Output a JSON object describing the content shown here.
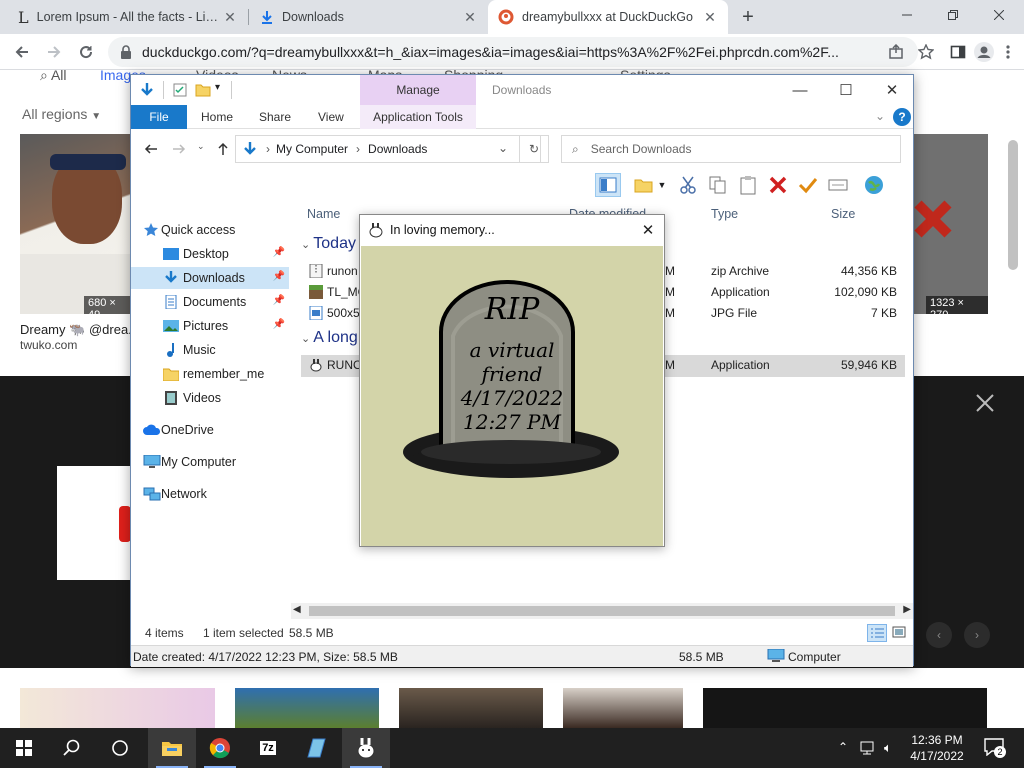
{
  "browser": {
    "tabs": [
      {
        "title": "Lorem Ipsum - All the facts - Lipsum",
        "favicon": "L"
      },
      {
        "title": "Downloads",
        "favicon": "download-icon"
      },
      {
        "title": "dreamybullxxx at DuckDuckGo",
        "favicon": "duckduckgo-icon",
        "active": true
      }
    ],
    "url": "duckduckgo.com/?q=dreamybullxxx&t=h_&iax=images&ia=images&iai=https%3A%2F%2Fei.phprcdn.com%2F..."
  },
  "ddg": {
    "tabs": [
      "All",
      "Images",
      "Videos",
      "News",
      "Maps",
      "Shopping",
      "Settings"
    ],
    "all_regions": "All regions",
    "result": {
      "title": "Dreamy",
      "emoji": "🐃",
      "handle": "@drea...",
      "source": "twuko.com",
      "dims": "680 × 49..."
    },
    "right_dims": "1323 × 270"
  },
  "explorer": {
    "manage": "Manage",
    "title": "Downloads",
    "ribbon": {
      "file": "File",
      "home": "Home",
      "share": "Share",
      "view": "View",
      "app_tools": "Application Tools"
    },
    "breadcrumb": [
      "My Computer",
      "Downloads"
    ],
    "search_placeholder": "Search Downloads",
    "nav": [
      {
        "label": "Quick access",
        "icon": "star-icon"
      },
      {
        "label": "Desktop",
        "icon": "desktop-icon",
        "pinned": true
      },
      {
        "label": "Downloads",
        "icon": "download-icon",
        "pinned": true,
        "selected": true
      },
      {
        "label": "Documents",
        "icon": "document-icon",
        "pinned": true
      },
      {
        "label": "Pictures",
        "icon": "picture-icon",
        "pinned": true
      },
      {
        "label": "Music",
        "icon": "music-icon"
      },
      {
        "label": "remember_me",
        "icon": "folder-icon"
      },
      {
        "label": "Videos",
        "icon": "video-icon"
      },
      {
        "label": "OneDrive",
        "icon": "cloud-icon"
      },
      {
        "label": "My Computer",
        "icon": "computer-icon"
      },
      {
        "label": "Network",
        "icon": "network-icon"
      }
    ],
    "columns": {
      "name": "Name",
      "date": "Date modified",
      "type": "Type",
      "size": "Size"
    },
    "groups": [
      "Today (",
      "A long"
    ],
    "files": [
      {
        "name": "runon",
        "date_tail": "M",
        "type": "zip Archive",
        "size": "44,356 KB"
      },
      {
        "name": "TL_MC",
        "date_tail": "M",
        "type": "Application",
        "size": "102,090 KB"
      },
      {
        "name": "500x50",
        "date_tail": "M",
        "type": "JPG File",
        "size": "7 KB"
      },
      {
        "name": "RUNO",
        "date_tail": "M",
        "type": "Application",
        "size": "59,946 KB",
        "selected": true
      }
    ],
    "status": {
      "items": "4 items",
      "selected": "1 item selected",
      "size": "58.5 MB"
    },
    "details": {
      "info": "Date created: 4/17/2022 12:23 PM, Size: 58.5 MB",
      "size": "58.5 MB",
      "location": "Computer"
    }
  },
  "popup": {
    "title": "In loving memory...",
    "lines": [
      "RIP",
      "a virtual",
      "friend",
      "4/17/2022",
      "12:27 PM"
    ]
  },
  "taskbar": {
    "time": "12:36 PM",
    "date": "4/17/2022",
    "notifications": "2"
  }
}
